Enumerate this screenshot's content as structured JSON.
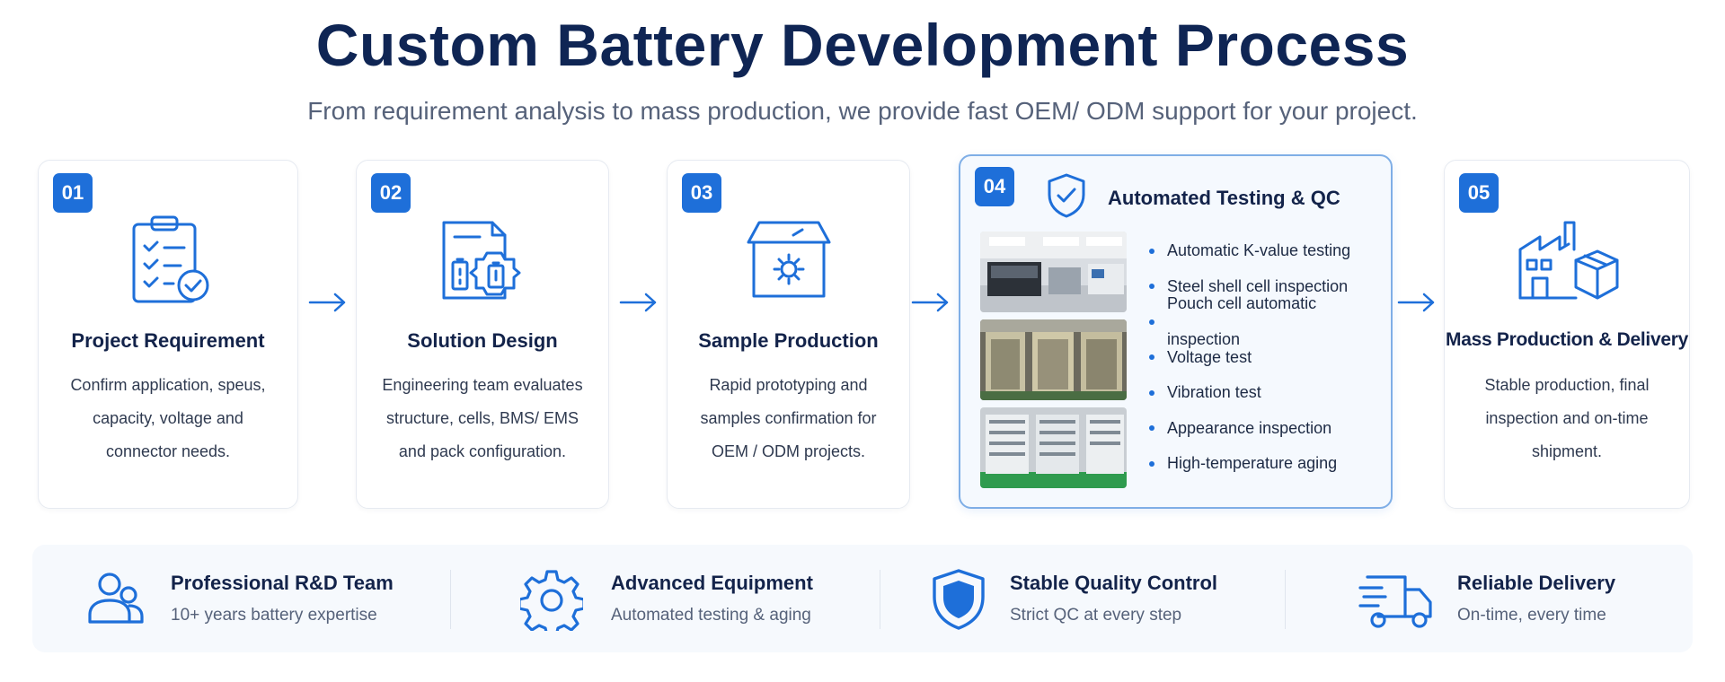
{
  "header": {
    "title": "Custom Battery Development Process",
    "subtitle": "From requirement analysis to mass production, we provide fast OEM/ ODM support for your project."
  },
  "steps": [
    {
      "number": "01",
      "icon": "clipboard-check-icon",
      "title": "Project Requirement",
      "desc": [
        "Confirm application, speus,",
        "capacity, voltage and",
        "connector needs."
      ]
    },
    {
      "number": "02",
      "icon": "battery-design-icon",
      "title": "Solution Design",
      "desc": [
        "Engineering team evaluates",
        "structure, cells, BMS/ EMS",
        "and pack configuration."
      ]
    },
    {
      "number": "03",
      "icon": "production-box-icon",
      "title": "Sample Production",
      "desc": [
        "Rapid prototyping and",
        "samples confirmation for",
        "OEM / ODM projects."
      ]
    },
    {
      "number": "04",
      "icon": "shield-check-icon",
      "title": "Automated Testing & QC",
      "photos": [
        "testing-lab-photo",
        "cell-inspection-photo",
        "aging-rack-photo"
      ],
      "items": [
        "Automatic K-value testing",
        "Steel shell cell inspection",
        "Pouch cell automatic inspection",
        "Voltage test",
        "Vibration test",
        "Appearance inspection",
        "High-temperature aging"
      ]
    },
    {
      "number": "05",
      "icon": "factory-icon",
      "title": "Mass Production & Delivery",
      "desc": [
        "Stable production, final",
        "inspection and on-time",
        "shipment."
      ]
    }
  ],
  "features": [
    {
      "icon": "team-icon",
      "title": "Professional R&D Team",
      "subtitle": "10+ years battery expertise"
    },
    {
      "icon": "gear-icon",
      "title": "Advanced Equipment",
      "subtitle": "Automated testing & aging"
    },
    {
      "icon": "shield-icon",
      "title": "Stable Quality Control",
      "subtitle": "Strict QC at every step"
    },
    {
      "icon": "delivery-truck-icon",
      "title": "Reliable Delivery",
      "subtitle": "On-time, every time"
    }
  ],
  "colors": {
    "accent": "#1e6fd9",
    "heading": "#0f2554",
    "featured_border": "#7faee6"
  }
}
